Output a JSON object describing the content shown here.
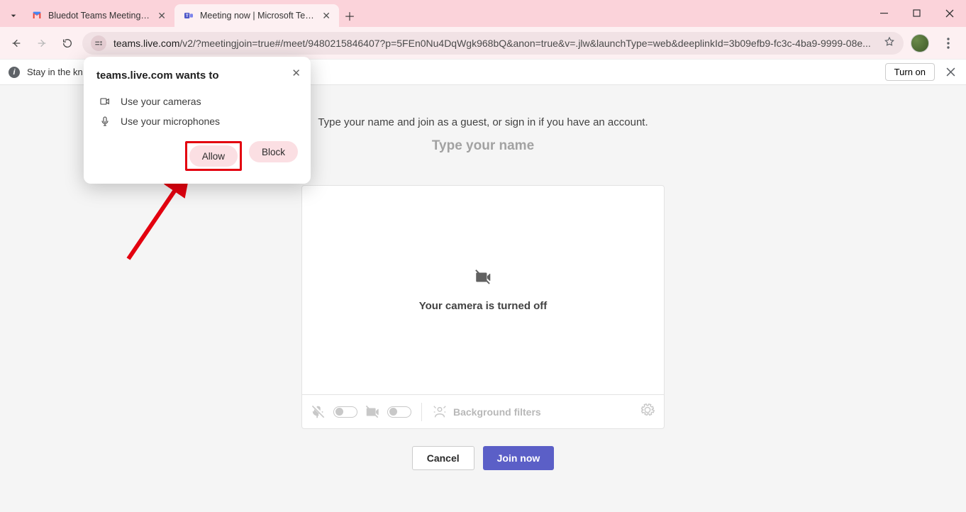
{
  "browser": {
    "tabs": [
      {
        "title": "Bluedot Teams Meeting - bea@"
      },
      {
        "title": "Meeting now | Microsoft Teams"
      }
    ],
    "url_origin": "teams.live.com",
    "url_path": "/v2/?meetingjoin=true#/meet/9480215846407?p=5FEn0Nu4DqWgk968bQ&anon=true&v=.jlw&launchType=web&deeplinkId=3b09efb9-fc3c-4ba9-9999-08e..."
  },
  "infobar": {
    "text": "Stay in the kn",
    "turn_on": "Turn on"
  },
  "permission": {
    "title": "teams.live.com wants to",
    "camera": "Use your cameras",
    "microphone": "Use your microphones",
    "allow": "Allow",
    "block": "Block"
  },
  "prejoin": {
    "instruction": "Type your name and join as a guest, or sign in if you have an account.",
    "name_placeholder": "Type your name",
    "camera_off": "Your camera is turned off",
    "background_filters": "Background filters",
    "cancel": "Cancel",
    "join": "Join now"
  }
}
